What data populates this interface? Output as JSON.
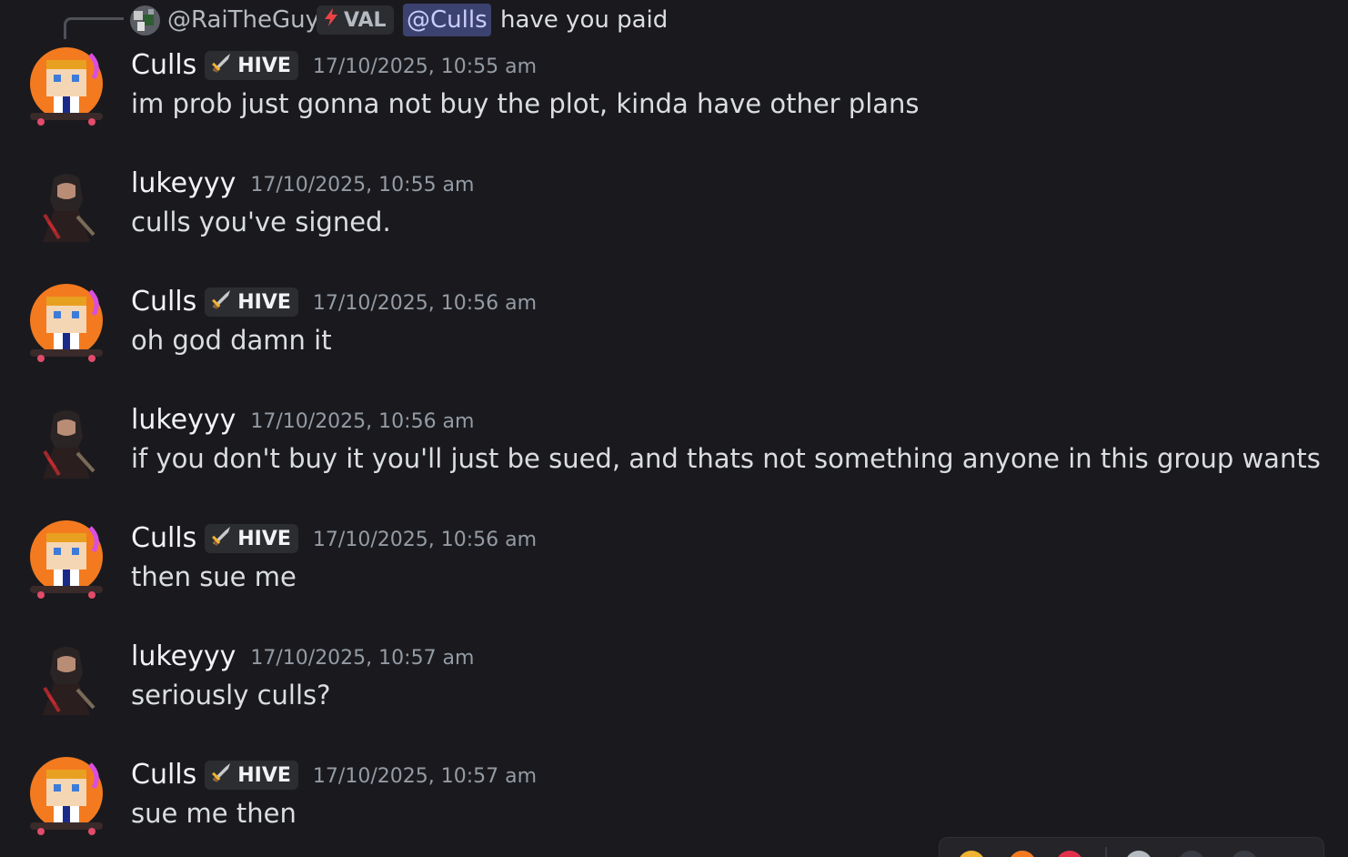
{
  "reply_preview": {
    "author": "@RaiTheGuy",
    "tag": {
      "icon": "lightning-icon",
      "label": "VAL",
      "icon_color": "#ed4245"
    },
    "mention": "@Culls",
    "text": "have you paid"
  },
  "messages": [
    {
      "author": "Culls",
      "tag": {
        "icon": "sword-icon",
        "label": "HIVE"
      },
      "timestamp": "17/10/2025, 10:55 am",
      "content": "im prob just gonna not buy the plot, kinda have other plans",
      "avatar": "culls-avatar"
    },
    {
      "author": "lukeyyy",
      "tag": null,
      "timestamp": "17/10/2025, 10:55 am",
      "content": "culls you've signed.",
      "avatar": "lukeyyy-avatar"
    },
    {
      "author": "Culls",
      "tag": {
        "icon": "sword-icon",
        "label": "HIVE"
      },
      "timestamp": "17/10/2025, 10:56 am",
      "content": "oh god damn it",
      "avatar": "culls-avatar"
    },
    {
      "author": "lukeyyy",
      "tag": null,
      "timestamp": "17/10/2025, 10:56 am",
      "content": "if you don't buy it you'll just be sued, and thats not something anyone in this group wants",
      "avatar": "lukeyyy-avatar"
    },
    {
      "author": "Culls",
      "tag": {
        "icon": "sword-icon",
        "label": "HIVE"
      },
      "timestamp": "17/10/2025, 10:56 am",
      "content": "then sue me",
      "avatar": "culls-avatar"
    },
    {
      "author": "lukeyyy",
      "tag": null,
      "timestamp": "17/10/2025, 10:57 am",
      "content": "seriously culls?",
      "avatar": "lukeyyy-avatar"
    },
    {
      "author": "Culls",
      "tag": {
        "icon": "sword-icon",
        "label": "HIVE"
      },
      "timestamp": "17/10/2025, 10:57 am",
      "content": "sue me then",
      "avatar": "culls-avatar"
    }
  ],
  "colors": {
    "background": "#1a1a1e",
    "username": "#f2f3f5",
    "timestamp": "#949ba4",
    "mention_bg": "#3c4270",
    "mention_text": "#c9cdfb"
  }
}
